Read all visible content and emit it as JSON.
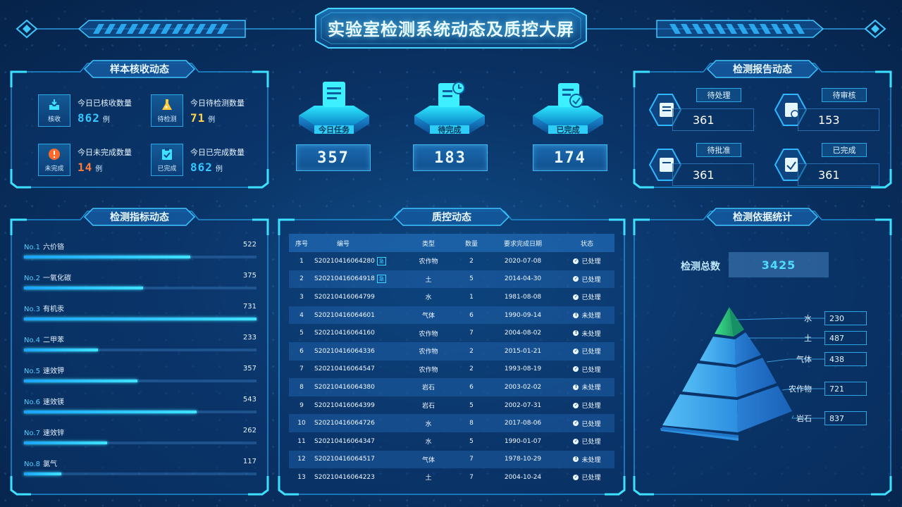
{
  "header": {
    "title": "实验室检测系统动态及质控大屏"
  },
  "sample_panel": {
    "title": "样本核收动态",
    "items": [
      {
        "icon": "inbox-icon",
        "tag": "核收",
        "label": "今日已核收数量",
        "value": "862",
        "unit": "例",
        "color": "#35c8ff"
      },
      {
        "icon": "flask-icon",
        "tag": "待检测",
        "label": "今日待检测数量",
        "value": "71",
        "unit": "例",
        "color": "#ffd54a"
      },
      {
        "icon": "alert-icon",
        "tag": "未完成",
        "label": "今日未完成数量",
        "value": "14",
        "unit": "例",
        "color": "#ff7a3a"
      },
      {
        "icon": "clipboard-check-icon",
        "tag": "已完成",
        "label": "今日已完成数量",
        "value": "862",
        "unit": "例",
        "color": "#35c8ff"
      }
    ]
  },
  "summary": [
    {
      "icon": "document-icon",
      "label": "今日任务",
      "value": "357"
    },
    {
      "icon": "document-clock-icon",
      "label": "待完成",
      "value": "183"
    },
    {
      "icon": "document-check-icon",
      "label": "已完成",
      "value": "174"
    }
  ],
  "report_panel": {
    "title": "检测报告动态",
    "items": [
      {
        "icon": "report-list-icon",
        "label": "待处理",
        "value": "361"
      },
      {
        "icon": "report-review-icon",
        "label": "待审核",
        "value": "153"
      },
      {
        "icon": "report-approve-icon",
        "label": "待批准",
        "value": "361"
      },
      {
        "icon": "report-done-icon",
        "label": "已完成",
        "value": "361"
      }
    ]
  },
  "indicator_panel": {
    "title": "检测指标动态",
    "max": 731,
    "items": [
      {
        "no": "No.1",
        "name": "六价铬",
        "value": 522
      },
      {
        "no": "No.2",
        "name": "一氧化碳",
        "value": 375
      },
      {
        "no": "No.3",
        "name": "有机汞",
        "value": 731
      },
      {
        "no": "No.4",
        "name": "二甲苯",
        "value": 233
      },
      {
        "no": "No.5",
        "name": "速效钾",
        "value": 357
      },
      {
        "no": "No.6",
        "name": "速效镁",
        "value": 543
      },
      {
        "no": "No.7",
        "name": "速效锌",
        "value": 262
      },
      {
        "no": "No.8",
        "name": "氯气",
        "value": 117
      }
    ]
  },
  "qc_panel": {
    "title": "质控动态",
    "columns": [
      "序号",
      "编号",
      "类型",
      "数量",
      "要求完成日期",
      "状态"
    ],
    "rows": [
      {
        "idx": "1",
        "code": "S20210416064280",
        "urgent": true,
        "type": "农作物",
        "qty": "2",
        "date": "2020-07-08",
        "status": "已处理",
        "done": true
      },
      {
        "idx": "2",
        "code": "S20210416064918",
        "urgent": true,
        "type": "土",
        "qty": "5",
        "date": "2014-04-30",
        "status": "已处理",
        "done": true
      },
      {
        "idx": "3",
        "code": "S20210416064799",
        "urgent": false,
        "type": "水",
        "qty": "1",
        "date": "1981-08-08",
        "status": "已处理",
        "done": true
      },
      {
        "idx": "4",
        "code": "S20210416064601",
        "urgent": false,
        "type": "气体",
        "qty": "6",
        "date": "1990-09-14",
        "status": "未处理",
        "done": false
      },
      {
        "idx": "5",
        "code": "S20210416064160",
        "urgent": false,
        "type": "农作物",
        "qty": "7",
        "date": "2004-08-02",
        "status": "未处理",
        "done": false
      },
      {
        "idx": "6",
        "code": "S20210416064336",
        "urgent": false,
        "type": "农作物",
        "qty": "2",
        "date": "2015-01-21",
        "status": "已处理",
        "done": true
      },
      {
        "idx": "7",
        "code": "S20210416064547",
        "urgent": false,
        "type": "农作物",
        "qty": "2",
        "date": "1993-08-19",
        "status": "已处理",
        "done": true
      },
      {
        "idx": "8",
        "code": "S20210416064380",
        "urgent": false,
        "type": "岩石",
        "qty": "6",
        "date": "2003-02-02",
        "status": "未处理",
        "done": false
      },
      {
        "idx": "9",
        "code": "S20210416064399",
        "urgent": false,
        "type": "岩石",
        "qty": "5",
        "date": "2002-07-31",
        "status": "已处理",
        "done": true
      },
      {
        "idx": "10",
        "code": "S20210416064726",
        "urgent": false,
        "type": "水",
        "qty": "8",
        "date": "2017-08-06",
        "status": "已处理",
        "done": true
      },
      {
        "idx": "11",
        "code": "S20210416064347",
        "urgent": false,
        "type": "水",
        "qty": "5",
        "date": "1990-01-07",
        "status": "已处理",
        "done": true
      },
      {
        "idx": "12",
        "code": "S20210416064517",
        "urgent": false,
        "type": "气体",
        "qty": "7",
        "date": "1978-10-29",
        "status": "未处理",
        "done": false
      },
      {
        "idx": "13",
        "code": "S20210416064223",
        "urgent": false,
        "type": "土",
        "qty": "7",
        "date": "2004-10-24",
        "status": "已处理",
        "done": true
      }
    ]
  },
  "basis_panel": {
    "title": "检测依据统计",
    "total_label": "检测总数",
    "total": "3425",
    "tiers": [
      {
        "label": "水",
        "value": "230"
      },
      {
        "label": "土",
        "value": "487"
      },
      {
        "label": "气体",
        "value": "438"
      },
      {
        "label": "农作物",
        "value": "721"
      },
      {
        "label": "岩石",
        "value": "837"
      }
    ]
  }
}
